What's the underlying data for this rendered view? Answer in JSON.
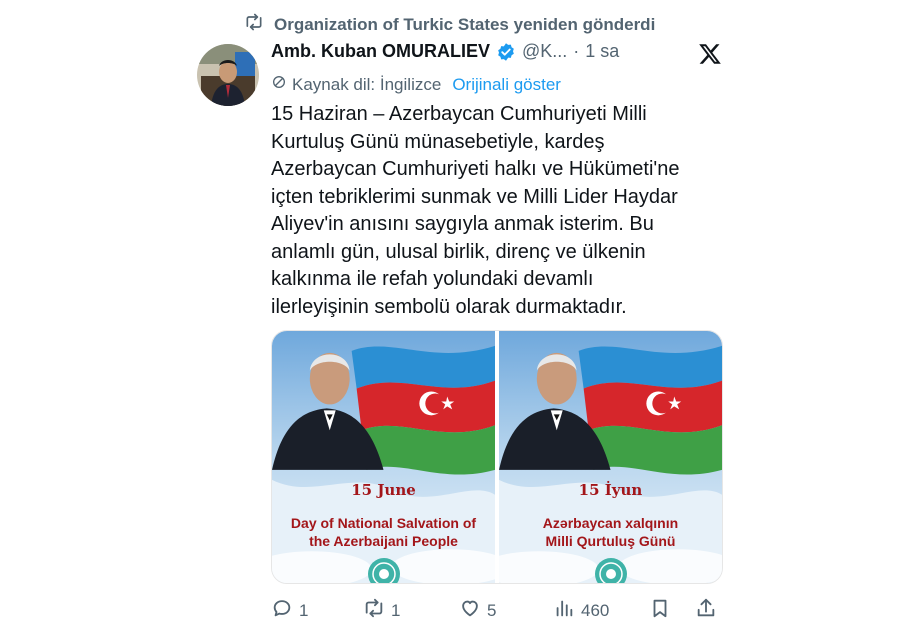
{
  "repost": {
    "text": "Organization of Turkic States yeniden gönderdi"
  },
  "author": {
    "name": "Amb. Kuban OMURALIEV",
    "handle": "@K...",
    "separator": "·",
    "time": "1 sa"
  },
  "translation": {
    "label": "Kaynak dil: İngilizce",
    "show_original": "Orijinali göster"
  },
  "tweet": {
    "text": "15 Haziran – Azerbaycan Cumhuriyeti Milli\nKurtuluş Günü münasebetiyle, kardeş\nAzerbaycan Cumhuriyeti halkı ve Hükümeti'ne\niçten tebriklerimi sunmak ve Milli Lider Haydar\nAliyev'in anısını saygıyla anmak isterim. Bu\nanlamlı gün, ulusal birlik, direnç ve ülkenin\nkalkınma ile refah yolundaki devamlı\nilerleyişinin sembolü olarak durmaktadır."
  },
  "media": {
    "cards": [
      {
        "date": "15 June",
        "caption": "Day of National Salvation of\nthe Azerbaijani People"
      },
      {
        "date": "15 İyun",
        "caption": "Azərbaycan xalqının\nMilli Qurtuluş Günü"
      }
    ]
  },
  "actions": {
    "replies": "1",
    "reposts": "1",
    "likes": "5",
    "views": "460"
  },
  "colors": {
    "accent": "#1d9bf0",
    "muted": "#536471",
    "text": "#0f1419",
    "poster_red": "#a3161a"
  }
}
